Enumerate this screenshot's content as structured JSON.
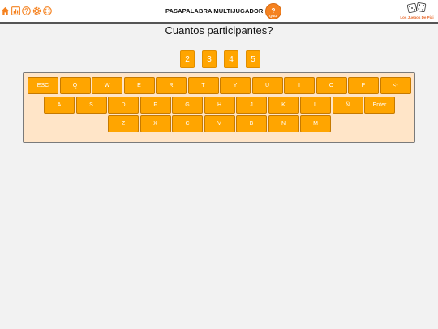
{
  "header": {
    "title": "PASAPALABRA MULTIJUGADOR",
    "nav_icons": [
      "home-icon",
      "stats-icon",
      "help-icon",
      "settings-icon",
      "fullscreen-icon"
    ],
    "logo_glyph": "?",
    "logo_text": "QUIZ",
    "brand_text": "Los Juegos De Pixi"
  },
  "prompt": {
    "question": "Cuantos participantes?",
    "options": [
      "2",
      "3",
      "4",
      "5"
    ]
  },
  "keyboard": {
    "row1": [
      "ESC",
      "Q",
      "W",
      "E",
      "R",
      "T",
      "Y",
      "U",
      "I",
      "O",
      "P",
      "<-"
    ],
    "row2": [
      "A",
      "S",
      "D",
      "F",
      "G",
      "H",
      "J",
      "K",
      "L",
      "Ñ",
      "Enter"
    ],
    "row3": [
      "Z",
      "X",
      "C",
      "V",
      "B",
      "N",
      "M"
    ]
  },
  "colors": {
    "accent": "#ffa500",
    "keyboard_bg": "#ffe5c8",
    "brand": "#e8682a",
    "icon": "#f58220"
  }
}
